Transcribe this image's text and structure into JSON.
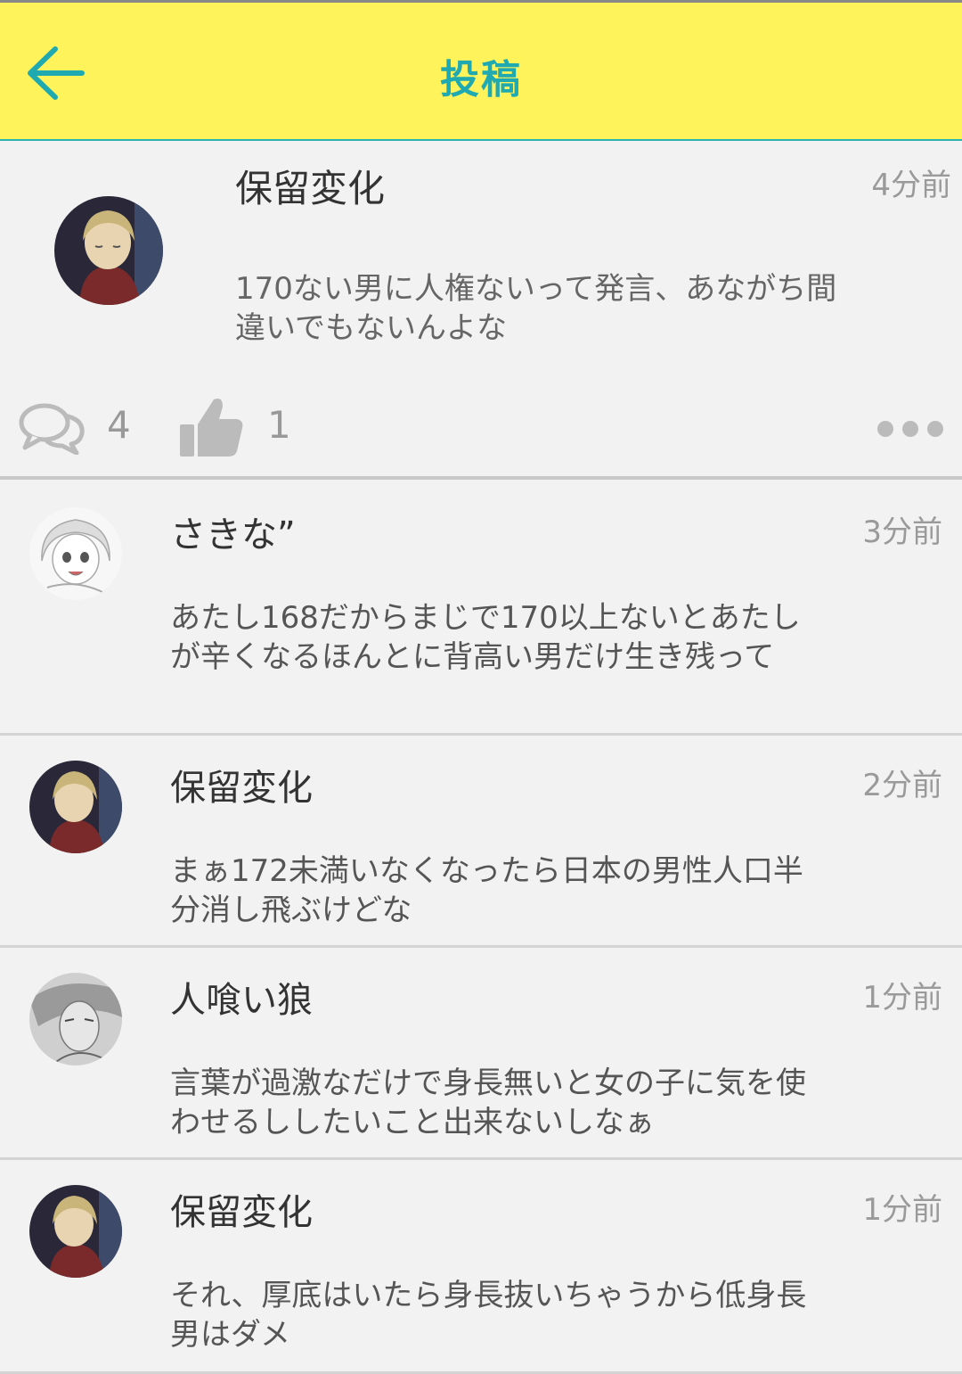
{
  "header": {
    "title": "投稿",
    "back_icon": "arrow-left-icon"
  },
  "colors": {
    "header_bg": "#fff35c",
    "accent": "#1fa9b0",
    "background": "#f2f2f2"
  },
  "post": {
    "author": "保留変化",
    "time": "4分前",
    "body": "170ない男に人権ないって発言、あながち間違いでもないんよな",
    "comment_count": "4",
    "like_count": "1"
  },
  "replies": [
    {
      "author": "さきな”",
      "time": "3分前",
      "body": "あたし168だからまじで170以上ないとあたしが辛くなるほんとに背高い男だけ生き残って"
    },
    {
      "author": "保留変化",
      "time": "2分前",
      "body": "まぁ172未満いなくなったら日本の男性人口半分消し飛ぶけどな"
    },
    {
      "author": "人喰い狼",
      "time": "1分前",
      "body": "言葉が過激なだけで身長無いと女の子に気を使わせるししたいこと出来ないしなぁ"
    },
    {
      "author": "保留変化",
      "time": "1分前",
      "body": "それ、厚底はいたら身長抜いちゃうから低身長男はダメ"
    }
  ]
}
